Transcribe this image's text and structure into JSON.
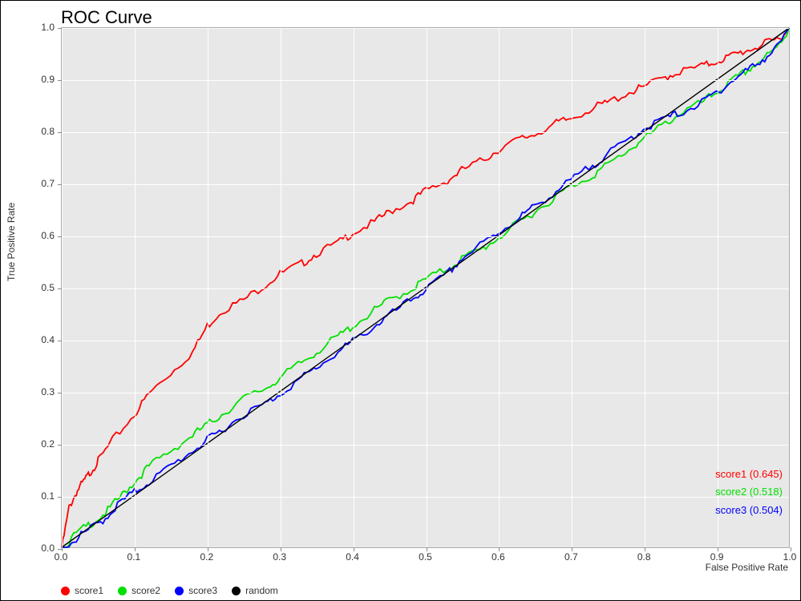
{
  "chart_data": {
    "type": "line",
    "title": "ROC Curve",
    "xlabel": "False Positive Rate",
    "ylabel": "True Positive Rate",
    "xlim": [
      0.0,
      1.0
    ],
    "ylim": [
      0.0,
      1.0
    ],
    "x_ticks": [
      0.0,
      0.1,
      0.2,
      0.3,
      0.4,
      0.5,
      0.6,
      0.7,
      0.8,
      0.9,
      1.0
    ],
    "y_ticks": [
      0.0,
      0.1,
      0.2,
      0.3,
      0.4,
      0.5,
      0.6,
      0.7,
      0.8,
      0.9,
      1.0
    ],
    "grid": true,
    "series": [
      {
        "name": "score1",
        "auc": 0.645,
        "color": "#ff0000",
        "x": [
          0.0,
          0.01,
          0.02,
          0.03,
          0.04,
          0.05,
          0.07,
          0.1,
          0.12,
          0.15,
          0.18,
          0.2,
          0.22,
          0.25,
          0.28,
          0.3,
          0.33,
          0.35,
          0.38,
          0.4,
          0.43,
          0.45,
          0.48,
          0.5,
          0.53,
          0.55,
          0.58,
          0.6,
          0.63,
          0.65,
          0.68,
          0.7,
          0.73,
          0.75,
          0.78,
          0.8,
          0.83,
          0.85,
          0.88,
          0.9,
          0.92,
          0.94,
          0.96,
          0.98,
          1.0
        ],
        "y": [
          0.0,
          0.08,
          0.11,
          0.13,
          0.15,
          0.17,
          0.21,
          0.26,
          0.3,
          0.34,
          0.38,
          0.43,
          0.46,
          0.48,
          0.51,
          0.53,
          0.55,
          0.57,
          0.59,
          0.61,
          0.63,
          0.65,
          0.67,
          0.69,
          0.71,
          0.73,
          0.75,
          0.77,
          0.79,
          0.8,
          0.82,
          0.83,
          0.85,
          0.86,
          0.88,
          0.89,
          0.91,
          0.92,
          0.93,
          0.94,
          0.95,
          0.96,
          0.97,
          0.98,
          1.0
        ]
      },
      {
        "name": "score2",
        "auc": 0.518,
        "color": "#00e000",
        "x": [
          0.0,
          0.02,
          0.04,
          0.06,
          0.08,
          0.1,
          0.12,
          0.15,
          0.18,
          0.2,
          0.22,
          0.25,
          0.28,
          0.3,
          0.33,
          0.35,
          0.38,
          0.4,
          0.43,
          0.45,
          0.48,
          0.5,
          0.53,
          0.55,
          0.58,
          0.6,
          0.63,
          0.65,
          0.68,
          0.7,
          0.73,
          0.75,
          0.78,
          0.8,
          0.83,
          0.85,
          0.88,
          0.9,
          0.92,
          0.94,
          0.96,
          0.98,
          1.0
        ],
        "y": [
          0.0,
          0.03,
          0.05,
          0.07,
          0.1,
          0.13,
          0.16,
          0.19,
          0.22,
          0.24,
          0.26,
          0.29,
          0.31,
          0.33,
          0.36,
          0.38,
          0.41,
          0.43,
          0.46,
          0.48,
          0.5,
          0.52,
          0.54,
          0.56,
          0.58,
          0.6,
          0.63,
          0.65,
          0.68,
          0.7,
          0.72,
          0.74,
          0.77,
          0.79,
          0.82,
          0.84,
          0.86,
          0.88,
          0.9,
          0.92,
          0.94,
          0.96,
          1.0
        ]
      },
      {
        "name": "score3",
        "auc": 0.504,
        "color": "#0000ff",
        "x": [
          0.0,
          0.02,
          0.04,
          0.06,
          0.08,
          0.1,
          0.12,
          0.15,
          0.18,
          0.2,
          0.22,
          0.25,
          0.28,
          0.3,
          0.33,
          0.35,
          0.38,
          0.4,
          0.43,
          0.45,
          0.48,
          0.5,
          0.53,
          0.55,
          0.58,
          0.6,
          0.63,
          0.65,
          0.68,
          0.7,
          0.73,
          0.75,
          0.78,
          0.8,
          0.83,
          0.85,
          0.88,
          0.9,
          0.92,
          0.94,
          0.96,
          0.98,
          1.0
        ],
        "y": [
          0.0,
          0.02,
          0.04,
          0.06,
          0.09,
          0.11,
          0.13,
          0.16,
          0.19,
          0.21,
          0.23,
          0.26,
          0.28,
          0.3,
          0.33,
          0.35,
          0.38,
          0.4,
          0.43,
          0.45,
          0.48,
          0.5,
          0.53,
          0.56,
          0.59,
          0.61,
          0.64,
          0.66,
          0.69,
          0.71,
          0.74,
          0.76,
          0.79,
          0.81,
          0.83,
          0.84,
          0.86,
          0.88,
          0.9,
          0.92,
          0.94,
          0.96,
          1.0
        ]
      },
      {
        "name": "random",
        "color": "#000000",
        "x": [
          0.0,
          1.0
        ],
        "y": [
          0.0,
          1.0
        ]
      }
    ],
    "annotations": [
      {
        "text": "score1 (0.645)",
        "color": "#ff0000",
        "y_frac": 0.13
      },
      {
        "text": "score2 (0.518)",
        "color": "#00e000",
        "y_frac": 0.095
      },
      {
        "text": "score3 (0.504)",
        "color": "#0000ff",
        "y_frac": 0.06
      }
    ],
    "legend": {
      "position": "bottom",
      "items": [
        {
          "label": "score1",
          "color": "#ff0000"
        },
        {
          "label": "score2",
          "color": "#00e000"
        },
        {
          "label": "score3",
          "color": "#0000ff"
        },
        {
          "label": "random",
          "color": "#000000"
        }
      ]
    }
  }
}
